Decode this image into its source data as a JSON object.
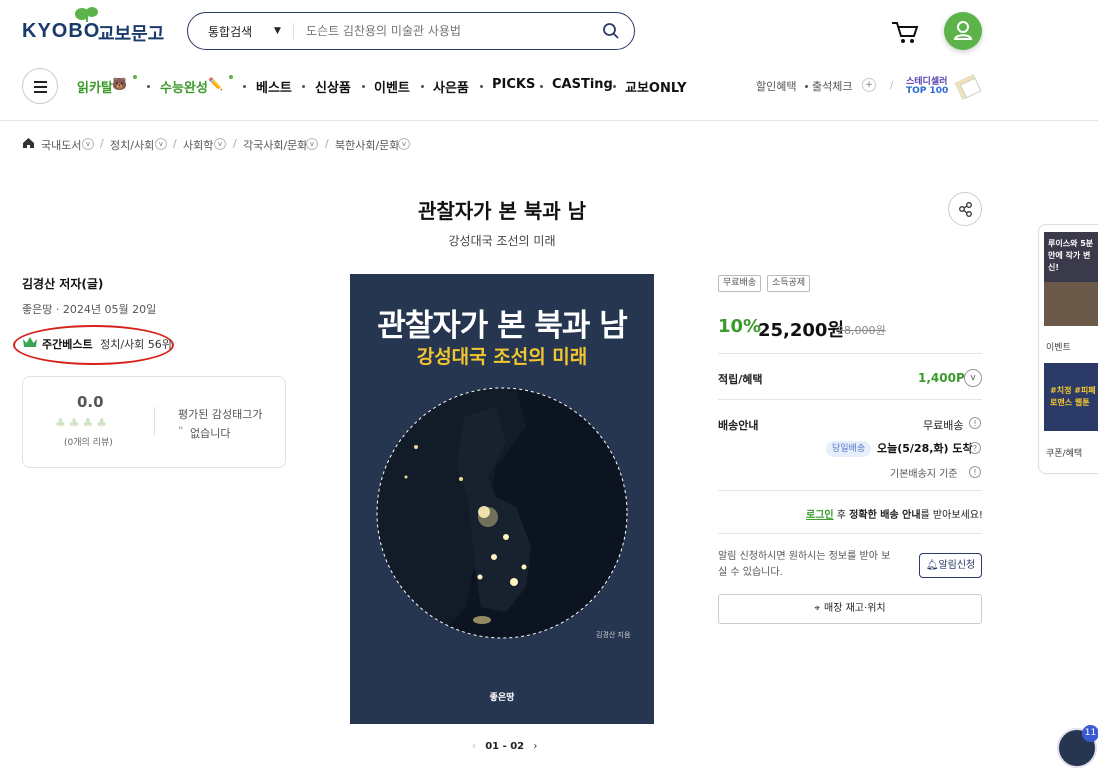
{
  "header": {
    "logo_en": "KYOBO",
    "logo_kr": "교보문고",
    "search": {
      "scope": "통합검색",
      "placeholder": "도슨트 김찬용의 미술관 사용법"
    }
  },
  "nav": {
    "items": [
      "읽카탈",
      "수능완성",
      "베스트",
      "신상품",
      "이벤트",
      "사은품",
      "PICKS",
      "CASTing",
      "교보ONLY"
    ],
    "utils": [
      "할인혜택",
      "출석체크"
    ],
    "steady_title": "스테디셀러",
    "steady_sub": "TOP 100"
  },
  "breadcrumb": [
    "국내도서",
    "정치/사회",
    "사회학",
    "각국사회/문화",
    "북한사회/문화"
  ],
  "book": {
    "title": "관찰자가 본 북과 남",
    "subtitle": "강성대국 조선의 미래",
    "author": "김경산 저자(글)",
    "pubinfo": "좋은땅 · 2024년 05월 20일",
    "best_label": "주간베스트",
    "best_rank": "정치/사회 56위",
    "cover_title": "관찰자가 본 북과 남",
    "cover_subtitle": "강성대국 조선의 미래",
    "cover_author": "김경산 지음",
    "cover_publisher": "좋은땅",
    "pager": "01 - 02"
  },
  "review": {
    "score": "0.0",
    "count": "(0개의 리뷰)",
    "tag_line1": "평가된 감성태그가",
    "tag_line2": "없습니다"
  },
  "purchase": {
    "badges": [
      "무료배송",
      "소득공제"
    ],
    "discount": "10%",
    "price": "25,200원",
    "original_price": "28,000원",
    "points_label": "적립/혜택",
    "points": "1,400P",
    "shipping_label": "배송안내",
    "shipping_free": "무료배송",
    "same_day": "당일배송",
    "delivery": "오늘(5/28,화) 도착",
    "shipping_base": "기본배송지 기준",
    "login_link": "로그인",
    "login_mid": " 후 ",
    "login_bold": "정확한 배송 안내",
    "login_end": "를 받아보세요!",
    "notice": "알림 신청하시면 원하시는 정보를 받아 보실 수 있습니다.",
    "alarm_button": "알림신청",
    "store_button": "매장 재고·위치"
  },
  "side": {
    "ad1_text": "루이스와 5분만에 작가 변신!",
    "event_label": "이벤트",
    "ad2_text": "#치정 #피폐 로맨스 웹툰",
    "coupon_label": "쿠폰/혜택",
    "fab_badge": "11"
  }
}
